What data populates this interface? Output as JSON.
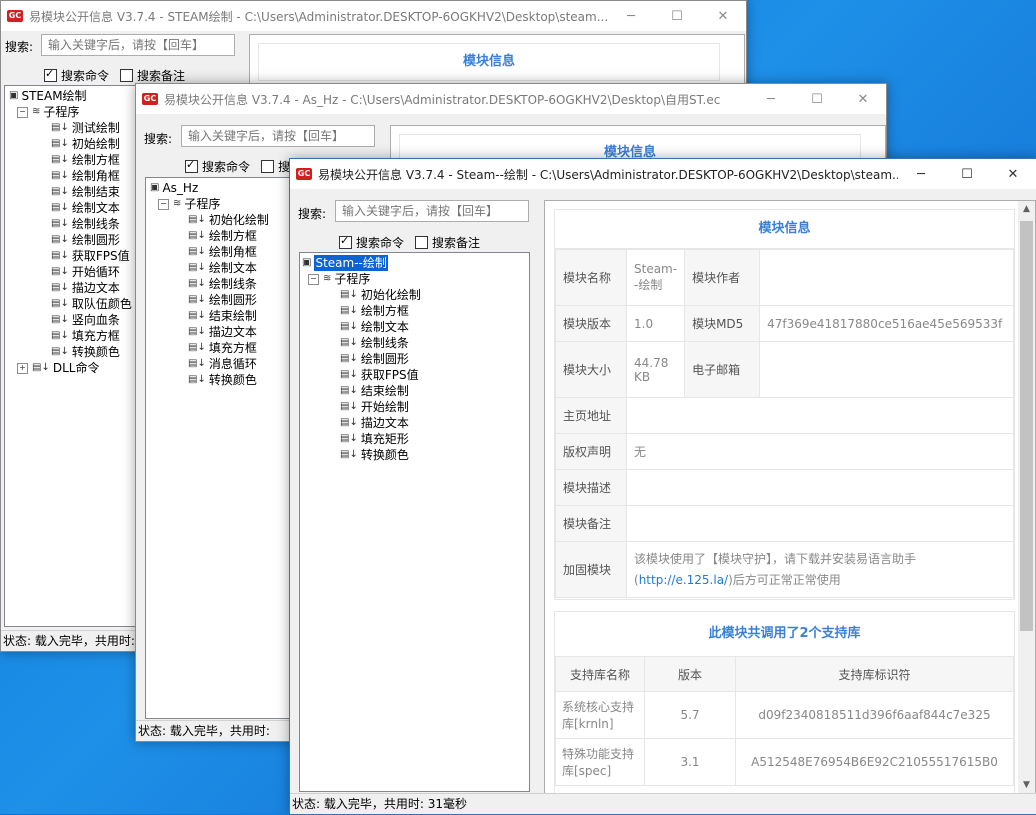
{
  "win1": {
    "title": "易模块公开信息 V3.7.4 - STEAM绘制 - C:\\Users\\Administrator.DESKTOP-6OGKHV2\\Desktop\\steam...",
    "search_label": "搜索:",
    "search_placeholder": "输入关键字后，请按【回车】",
    "chk_cmd": "搜索命令",
    "chk_note": "搜索备注",
    "panel_title": "模块信息",
    "tree_root": "STEAM绘制",
    "tree_group": "子程序",
    "tree_items": [
      "测试绘制",
      "初始绘制",
      "绘制方框",
      "绘制角框",
      "绘制结束",
      "绘制文本",
      "绘制线条",
      "绘制圆形",
      "获取FPS值",
      "开始循环",
      "描边文本",
      "取队伍颜色",
      "竖向血条",
      "填充方框",
      "转换颜色"
    ],
    "tree_dll": "DLL命令",
    "status": "状态:  载入完毕，共用时:"
  },
  "win2": {
    "title": "易模块公开信息 V3.7.4 - As_Hz - C:\\Users\\Administrator.DESKTOP-6OGKHV2\\Desktop\\自用ST.ec",
    "search_label": "搜索:",
    "search_placeholder": "输入关键字后，请按【回车】",
    "chk_cmd": "搜索命令",
    "chk_note": "搜",
    "panel_title": "模块信息",
    "tree_root": "As_Hz",
    "tree_group": "子程序",
    "tree_items": [
      "初始化绘制",
      "绘制方框",
      "绘制角框",
      "绘制文本",
      "绘制线条",
      "绘制圆形",
      "结束绘制",
      "描边文本",
      "填充方框",
      "消息循环",
      "转换颜色"
    ],
    "status": "状态:  载入完毕，共用时:"
  },
  "win3": {
    "title": "易模块公开信息 V3.7.4 - Steam--绘制 - C:\\Users\\Administrator.DESKTOP-6OGKHV2\\Desktop\\steam...",
    "search_label": "搜索:",
    "search_placeholder": "输入关键字后，请按【回车】",
    "chk_cmd": "搜索命令",
    "chk_note": "搜索备注",
    "tree_root": "Steam--绘制",
    "tree_group": "子程序",
    "tree_items": [
      "初始化绘制",
      "绘制方框",
      "绘制文本",
      "绘制线条",
      "绘制圆形",
      "获取FPS值",
      "结束绘制",
      "开始绘制",
      "描边文本",
      "填充矩形",
      "转换颜色"
    ],
    "status": "状态:  载入完毕，共用时: 31毫秒",
    "info": {
      "title": "模块信息",
      "name_label": "模块名称",
      "name_value": "Steam--绘制",
      "author_label": "模块作者",
      "author_value": "",
      "version_label": "模块版本",
      "version_value": "1.0",
      "md5_label": "模块MD5",
      "md5_value": "47f369e41817880ce516ae45e569533f",
      "size_label": "模块大小",
      "size_value": "44.78 KB",
      "email_label": "电子邮箱",
      "email_value": "",
      "home_label": "主页地址",
      "home_value": "",
      "copyright_label": "版权声明",
      "copyright_value": "无",
      "desc_label": "模块描述",
      "desc_value": "",
      "note_label": "模块备注",
      "note_value": "",
      "encrypt_label": "加固模块",
      "encrypt_text1": "该模块使用了【模块守护】，请下载并安装易语言助手(",
      "encrypt_link": "http://e.125.la/",
      "encrypt_text2": ")后方可正常正常使用"
    },
    "libs": {
      "title": "此模块共调用了2个支持库",
      "headers": [
        "支持库名称",
        "版本",
        "支持库标识符"
      ],
      "rows": [
        {
          "name": "系统核心支持库[krnln]",
          "version": "5.7",
          "id": "d09f2340818511d396f6aaf844c7e325"
        },
        {
          "name": "特殊功能支持库[spec]",
          "version": "3.1",
          "id": "A512548E76954B6E92C21055517615B0"
        }
      ]
    }
  },
  "window_controls": {
    "minimize": "─",
    "maximize": "☐",
    "close": "✕"
  }
}
